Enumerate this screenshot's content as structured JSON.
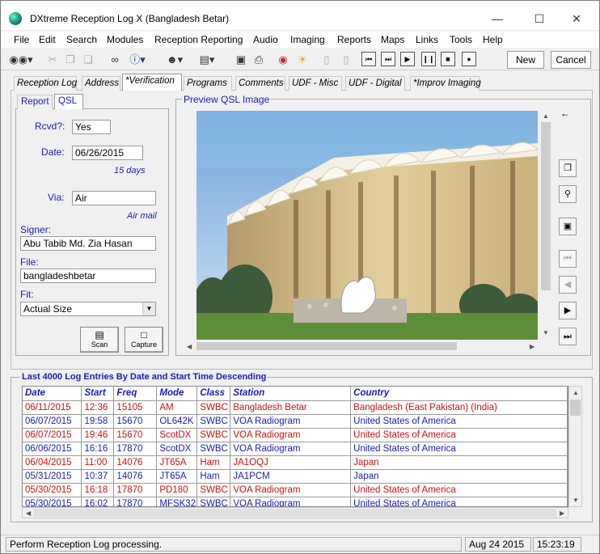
{
  "window": {
    "title": "DXtreme Reception Log X (Bangladesh Betar)"
  },
  "menu": [
    "File",
    "Edit",
    "Search",
    "Modules",
    "Reception Reporting",
    "Audio",
    "Imaging",
    "Reports",
    "Maps",
    "Links",
    "Tools",
    "Help"
  ],
  "toolbar": {
    "new_label": "New",
    "cancel_label": "Cancel"
  },
  "tabs": [
    "Reception Log",
    "Address",
    "*Verification",
    "Programs",
    "Comments",
    "UDF - Misc",
    "UDF - Digital",
    "*Improv Imaging"
  ],
  "subtabs": [
    "Report",
    "QSL"
  ],
  "form": {
    "rcvd_label": "Rcvd?:",
    "rcvd_value": "Yes",
    "date_label": "Date:",
    "date_value": "06/26/2015",
    "days_note": "15 days",
    "via_label": "Via:",
    "via_value": "Air",
    "via_note": "Air mail",
    "signer_label": "Signer:",
    "signer_value": "Abu Tabib Md. Zia Hasan",
    "file_label": "File:",
    "file_value": "bangladeshbetar",
    "fit_label": "Fit:",
    "fit_value": "Actual Size",
    "scan_label": "Scan",
    "capture_label": "Capture"
  },
  "preview": {
    "label": "Preview QSL Image"
  },
  "log": {
    "label": "Last 4000 Log Entries By Date and Start Time Descending",
    "columns": [
      "Date",
      "Start",
      "Freq",
      "Mode",
      "Class",
      "Station",
      "Country"
    ],
    "rows": [
      {
        "c": "r",
        "v": [
          "06/11/2015",
          "12:36",
          "15105",
          "AM",
          "SWBC",
          "Bangladesh Betar",
          "Bangladesh (East Pakistan) (India)"
        ]
      },
      {
        "c": "b",
        "v": [
          "06/07/2015",
          "19:58",
          "15670",
          "OL642K",
          "SWBC",
          "VOA Radiogram",
          "United States of America"
        ]
      },
      {
        "c": "r",
        "v": [
          "06/07/2015",
          "19:46",
          "15670",
          "ScotDX",
          "SWBC",
          "VOA Radiogram",
          "United States of America"
        ]
      },
      {
        "c": "b",
        "v": [
          "06/06/2015",
          "16:16",
          "17870",
          "ScotDX",
          "SWBC",
          "VOA Radiogram",
          "United States of America"
        ]
      },
      {
        "c": "r",
        "v": [
          "06/04/2015",
          "11:00",
          "14076",
          "JT65A",
          "Ham",
          "JA1OQJ",
          "Japan"
        ]
      },
      {
        "c": "b",
        "v": [
          "05/31/2015",
          "10:37",
          "14076",
          "JT65A",
          "Ham",
          "JA1PCM",
          "Japan"
        ]
      },
      {
        "c": "r",
        "v": [
          "05/30/2015",
          "16:18",
          "17870",
          "PD180",
          "SWBC",
          "VOA Radiogram",
          "United States of America"
        ]
      },
      {
        "c": "b",
        "v": [
          "05/30/2015",
          "16:02",
          "17870",
          "MFSK32",
          "SWBC",
          "VOA Radiogram",
          "United States of America"
        ]
      }
    ]
  },
  "status": {
    "message": "Perform Reception Log processing.",
    "date": "Aug 24 2015",
    "time": "15:23:19"
  },
  "colors": {
    "red": "#d01010",
    "blue": "#1a1ac0"
  }
}
